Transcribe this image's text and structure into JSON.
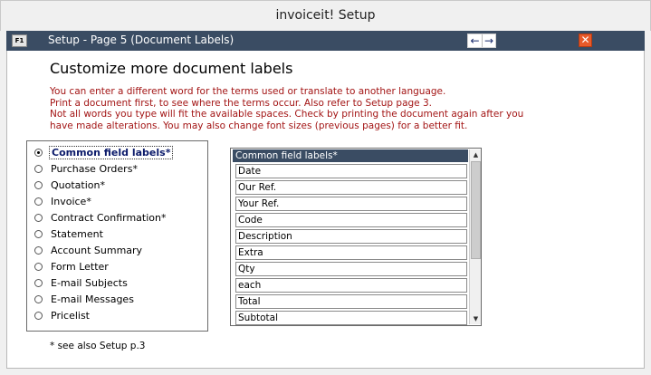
{
  "window": {
    "title": "invoiceit! Setup"
  },
  "header": {
    "f1_label": "F1",
    "title": "Setup - Page 5 (Document Labels)",
    "prev_icon": "arrow-left-icon",
    "next_icon": "arrow-right-icon",
    "close_icon": "close-icon",
    "close_glyph": "✕"
  },
  "page": {
    "heading": "Customize more document labels",
    "instructions": [
      "You can enter a different word for the terms used or translate to another language.",
      "Print a document first, to see where the terms occur. Also refer to Setup page 3.",
      "Not all words you type will fit the available spaces. Check by printing the document again after you",
      "have made alterations. You may also change font sizes (previous pages) for a better fit."
    ],
    "footnote": "* see also Setup p.3"
  },
  "options": [
    {
      "label": "Common field labels*",
      "selected": true
    },
    {
      "label": "Purchase Orders*",
      "selected": false
    },
    {
      "label": "Quotation*",
      "selected": false
    },
    {
      "label": "Invoice*",
      "selected": false
    },
    {
      "label": "Contract Confirmation*",
      "selected": false
    },
    {
      "label": "Statement",
      "selected": false
    },
    {
      "label": "Account Summary",
      "selected": false
    },
    {
      "label": "Form Letter",
      "selected": false
    },
    {
      "label": "E-mail Subjects",
      "selected": false
    },
    {
      "label": "E-mail Messages",
      "selected": false
    },
    {
      "label": "Pricelist",
      "selected": false
    }
  ],
  "grid": {
    "header": "Common field labels*",
    "rows": [
      "Date",
      "Our Ref.",
      "Your Ref.",
      "Code",
      "Description",
      "Extra",
      "Qty",
      "each",
      "Total",
      "Subtotal"
    ],
    "scroll_up_glyph": "▲",
    "scroll_down_glyph": "▼"
  },
  "colors": {
    "header_bar": "#3a4c63",
    "instruction_text": "#a31515",
    "close_button": "#e85a2a"
  }
}
